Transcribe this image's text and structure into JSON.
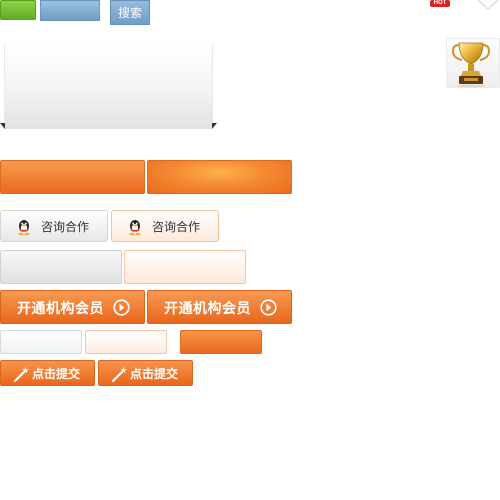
{
  "toolbar": {
    "search_label": "搜索"
  },
  "badge": {
    "hot_label": "HOT"
  },
  "consult": {
    "label": "咨询合作"
  },
  "member": {
    "label": "开通机构会员"
  },
  "submit": {
    "label": "点击提交"
  },
  "icons": {
    "qq": "qq-penguin-icon",
    "trophy": "trophy-icon",
    "arrow": "circle-arrow-right-icon",
    "wand": "magic-wand-icon",
    "corner": "chevron-down-icon"
  },
  "colors": {
    "orange": "#ea6a1d",
    "orange_light": "#f89a52",
    "blue": "#6d9cc4",
    "green": "#5fae23",
    "hot_red": "#d9252a",
    "peach_border": "#f2c3a6"
  }
}
